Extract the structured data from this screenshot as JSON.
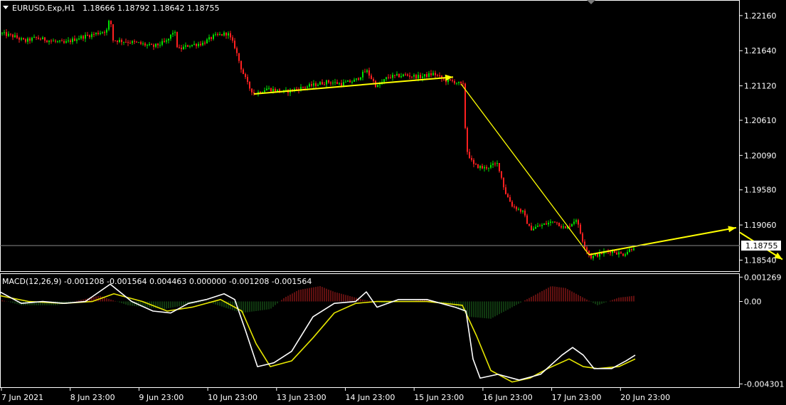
{
  "header": {
    "symbol": "EURUSD.Exp,H1",
    "ohlc": "1.18666 1.18792 1.18642 1.18755"
  },
  "macd_header": "MACD(12,26,9) -0.001208 -0.001564 0.004463 0.000000 -0.001208 -0.001564",
  "colors": {
    "background": "#000000",
    "frame": "#ffffff",
    "bull": "#00e000",
    "bear": "#ff2020",
    "trend": "#ffff00",
    "macd_line": "#ffffff",
    "signal_line": "#e6e600",
    "hist_pos": "#c02020",
    "hist_neg": "#207020"
  },
  "chart_data": [
    {
      "type": "candlestick",
      "symbol": "EURUSD.Exp",
      "timeframe": "H1",
      "ylim": [
        1.18376,
        1.2238
      ],
      "yticks": [
        "1.22160",
        "1.21640",
        "1.21120",
        "1.20610",
        "1.20090",
        "1.19580",
        "1.19060",
        "1.18540"
      ],
      "current_price": "1.18755",
      "xticks": [
        "7 Jun 2021",
        "8 Jun 23:00",
        "9 Jun 23:00",
        "10 Jun 23:00",
        "13 Jun 23:00",
        "14 Jun 23:00",
        "15 Jun 23:00",
        "16 Jun 23:00",
        "17 Jun 23:00",
        "20 Jun 23:00"
      ],
      "price_path": [
        [
          0,
          1.219
        ],
        [
          20,
          1.2185
        ],
        [
          35,
          1.2178
        ],
        [
          50,
          1.2183
        ],
        [
          70,
          1.2179
        ],
        [
          90,
          1.2175
        ],
        [
          110,
          1.2183
        ],
        [
          130,
          1.2188
        ],
        [
          150,
          1.2194
        ],
        [
          155,
          1.2215
        ],
        [
          158,
          1.218
        ],
        [
          175,
          1.2178
        ],
        [
          195,
          1.2175
        ],
        [
          215,
          1.217
        ],
        [
          235,
          1.2178
        ],
        [
          245,
          1.2195
        ],
        [
          250,
          1.2165
        ],
        [
          265,
          1.2172
        ],
        [
          285,
          1.2175
        ],
        [
          300,
          1.2185
        ],
        [
          320,
          1.219
        ],
        [
          330,
          1.217
        ],
        [
          340,
          1.2135
        ],
        [
          350,
          1.211
        ],
        [
          358,
          1.21
        ],
        [
          375,
          1.2108
        ],
        [
          400,
          1.2103
        ],
        [
          420,
          1.2108
        ],
        [
          440,
          1.2113
        ],
        [
          460,
          1.2118
        ],
        [
          480,
          1.2115
        ],
        [
          500,
          1.212
        ],
        [
          515,
          1.2135
        ],
        [
          530,
          1.211
        ],
        [
          545,
          1.2125
        ],
        [
          570,
          1.2128
        ],
        [
          590,
          1.2125
        ],
        [
          610,
          1.213
        ],
        [
          625,
          1.212
        ],
        [
          640,
          1.2118
        ],
        [
          652,
          1.2112
        ],
        [
          655,
          1.202
        ],
        [
          665,
          1.1995
        ],
        [
          680,
          1.199
        ],
        [
          700,
          1.1997
        ],
        [
          710,
          1.1955
        ],
        [
          720,
          1.1935
        ],
        [
          735,
          1.1925
        ],
        [
          745,
          1.19
        ],
        [
          760,
          1.1905
        ],
        [
          780,
          1.1912
        ],
        [
          795,
          1.19
        ],
        [
          810,
          1.1915
        ],
        [
          820,
          1.188
        ],
        [
          830,
          1.1858
        ],
        [
          845,
          1.1864
        ],
        [
          860,
          1.1868
        ],
        [
          875,
          1.1862
        ],
        [
          893,
          1.1875
        ]
      ],
      "trend_lines": [
        {
          "from": [
            357,
            1.21
          ],
          "to": [
            637,
            1.2125
          ],
          "arrow": true
        },
        {
          "from": [
            648,
            1.2115
          ],
          "to": [
            828,
            1.1862
          ],
          "arrow": false
        },
        {
          "from": [
            828,
            1.1862
          ],
          "to": [
            1035,
            1.1902
          ],
          "arrow": true
        },
        {
          "from": [
            1040,
            1.1895
          ],
          "to": [
            1100,
            1.1855
          ],
          "arrow": true
        }
      ]
    },
    {
      "type": "macd",
      "params": "MACD(12,26,9)",
      "ylim": [
        -0.00451,
        0.00143
      ],
      "yticks": [
        "0.001269",
        "0.00",
        "-0.004301"
      ],
      "macd": [
        [
          0,
          0.0005
        ],
        [
          30,
          -0.0001
        ],
        [
          60,
          0.0
        ],
        [
          90,
          -0.0001
        ],
        [
          120,
          0.0
        ],
        [
          155,
          0.0009
        ],
        [
          185,
          0.0
        ],
        [
          215,
          -0.0005
        ],
        [
          240,
          -0.0006
        ],
        [
          265,
          -0.0001
        ],
        [
          290,
          0.0001
        ],
        [
          315,
          0.0004
        ],
        [
          330,
          0.0001
        ],
        [
          345,
          -0.0015
        ],
        [
          362,
          -0.0034
        ],
        [
          385,
          -0.0032
        ],
        [
          410,
          -0.0026
        ],
        [
          440,
          -0.0008
        ],
        [
          470,
          -0.0001
        ],
        [
          500,
          0.0
        ],
        [
          515,
          0.0005
        ],
        [
          530,
          -0.0003
        ],
        [
          560,
          0.0001
        ],
        [
          600,
          0.0001
        ],
        [
          640,
          -0.0003
        ],
        [
          655,
          -0.0005
        ],
        [
          665,
          -0.003
        ],
        [
          675,
          -0.004
        ],
        [
          700,
          -0.0038
        ],
        [
          730,
          -0.0041
        ],
        [
          760,
          -0.0038
        ],
        [
          790,
          -0.0028
        ],
        [
          805,
          -0.0024
        ],
        [
          820,
          -0.0028
        ],
        [
          835,
          -0.0035
        ],
        [
          860,
          -0.0035
        ],
        [
          880,
          -0.0031
        ],
        [
          893,
          -0.0028
        ]
      ],
      "signal": [
        [
          0,
          0.0003
        ],
        [
          40,
          0.0
        ],
        [
          90,
          -0.0001
        ],
        [
          130,
          0.0
        ],
        [
          160,
          0.0004
        ],
        [
          200,
          0.0
        ],
        [
          235,
          -0.0005
        ],
        [
          270,
          -0.0003
        ],
        [
          310,
          0.0001
        ],
        [
          340,
          -0.0005
        ],
        [
          360,
          -0.0022
        ],
        [
          380,
          -0.0034
        ],
        [
          410,
          -0.0031
        ],
        [
          440,
          -0.0019
        ],
        [
          470,
          -0.0006
        ],
        [
          500,
          -0.0001
        ],
        [
          530,
          0.0
        ],
        [
          560,
          0.0
        ],
        [
          600,
          0.0
        ],
        [
          650,
          -0.0002
        ],
        [
          670,
          -0.0018
        ],
        [
          690,
          -0.0036
        ],
        [
          720,
          -0.0042
        ],
        [
          745,
          -0.004
        ],
        [
          770,
          -0.0035
        ],
        [
          800,
          -0.003
        ],
        [
          820,
          -0.0034
        ],
        [
          840,
          -0.0035
        ],
        [
          870,
          -0.0034
        ],
        [
          893,
          -0.003
        ]
      ],
      "histogram": [
        [
          0,
          0.0001
        ],
        [
          30,
          -0.0002
        ],
        [
          80,
          -0.0002
        ],
        [
          140,
          0.0003
        ],
        [
          180,
          -0.0002
        ],
        [
          230,
          -0.0004
        ],
        [
          290,
          0.0
        ],
        [
          340,
          -0.0006
        ],
        [
          380,
          -0.0004
        ],
        [
          400,
          0.0002
        ],
        [
          420,
          0.0006
        ],
        [
          450,
          0.0008
        ],
        [
          470,
          0.0005
        ],
        [
          510,
          0.0001
        ],
        [
          540,
          -0.0001
        ],
        [
          600,
          0.0001
        ],
        [
          640,
          -0.0002
        ],
        [
          660,
          -0.0008
        ],
        [
          690,
          -0.0009
        ],
        [
          720,
          -0.0003
        ],
        [
          750,
          0.0003
        ],
        [
          775,
          0.0008
        ],
        [
          795,
          0.0007
        ],
        [
          820,
          0.0002
        ],
        [
          840,
          -0.0002
        ],
        [
          870,
          0.0002
        ],
        [
          893,
          0.0003
        ]
      ]
    }
  ]
}
